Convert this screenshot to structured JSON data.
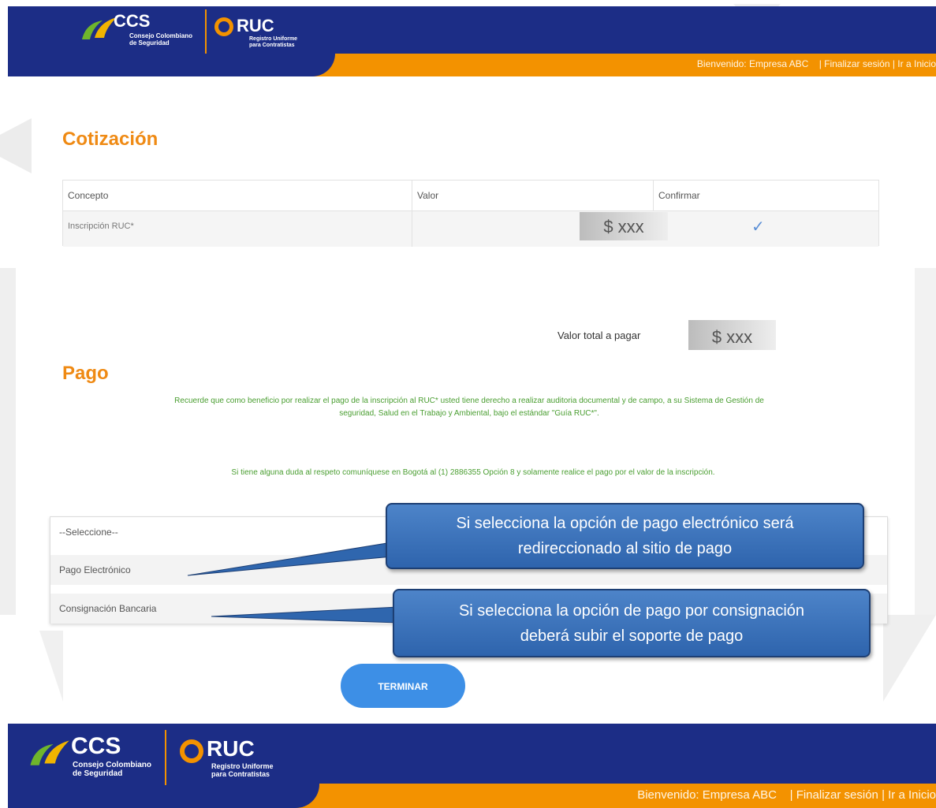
{
  "header": {
    "ccs": {
      "name": "CCS",
      "line1": "Consejo Colombiano",
      "line2": "de Seguridad"
    },
    "ruc": {
      "name": "RUC",
      "line1": "Registro Uniforme",
      "line2": "para Contratistas"
    },
    "welcome": "Bienvenido: Empresa ABC",
    "logout": "| Finalizar sesión",
    "home": "| Ir a Inicio"
  },
  "quote": {
    "title": "Cotización",
    "columns": [
      "Concepto",
      "Valor",
      "Confirmar"
    ],
    "rows": [
      {
        "concept": "Inscripción RUC*",
        "value": "$ xxx",
        "confirmed": "✓"
      }
    ],
    "total_label": "Valor total a pagar",
    "total_value": "$ xxx"
  },
  "payment": {
    "title": "Pago",
    "notice": "Recuerde que como beneficio por realizar el pago de la inscripción al RUC* usted tiene derecho a realizar auditoria documental y de campo, a su Sistema de Gestión de seguridad, Salud en el Trabajo y Ambiental, bajo el estándar \"Guía RUC*\".",
    "contact": "Si tiene alguna duda al respeto comuníquese en Bogotá al (1) 2886355 Opción 8 y solamente realice el pago por el valor de la inscripción.",
    "options": [
      "--Seleccione--",
      "Pago Electrónico",
      "Consignación Bancaria"
    ],
    "callout_electronic": "Si selecciona la opción de pago electrónico será redireccionado al sitio de pago",
    "callout_deposit": "Si selecciona la opción de pago por consignación deberá subir el soporte de pago",
    "submit": "TERMINAR"
  },
  "footer": {
    "ccs": {
      "name": "CCS",
      "line1": "Consejo Colombiano",
      "line2": "de Seguridad"
    },
    "ruc": {
      "name": "RUC",
      "line1": "Registro Uniforme",
      "line2": "para Contratistas"
    },
    "welcome": "Bienvenido: Empresa ABC",
    "logout": "| Finalizar sesión",
    "home": "| Ir a Inicio"
  },
  "colors": {
    "navy": "#1c2d86",
    "orange": "#f39200",
    "green": "#4a9e31",
    "button": "#3d8fe6"
  }
}
